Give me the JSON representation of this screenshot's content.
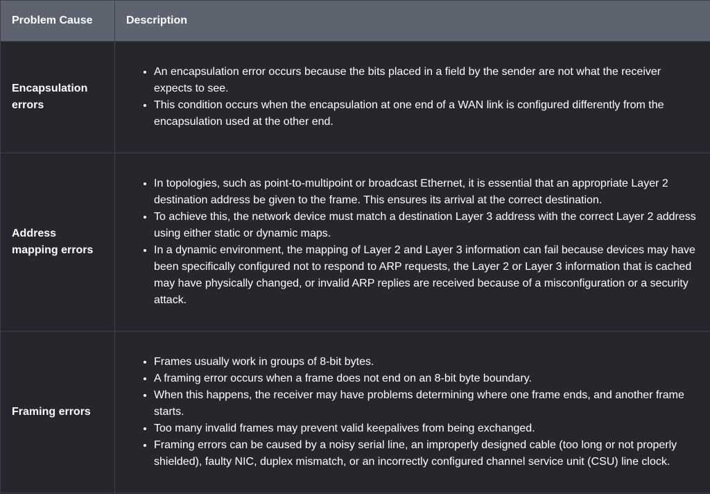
{
  "table": {
    "headers": [
      "Problem Cause",
      "Description"
    ],
    "rows": [
      {
        "cause": "Encapsulation errors",
        "bullets": [
          "An encapsulation error occurs because the bits placed in a field by the sender are not what the receiver expects to see.",
          "This condition occurs when the encapsulation at one end of a WAN link is configured differently from the encapsulation used at the other end."
        ]
      },
      {
        "cause": "Address mapping errors",
        "bullets": [
          "In topologies, such as point-to-multipoint or broadcast Ethernet, it is essential that an appropriate Layer 2 destination address be given to the frame. This ensures its arrival at the correct destination.",
          "To achieve this, the network device must match a destination Layer 3 address with the correct Layer 2 address using either static or dynamic maps.",
          "In a dynamic environment, the mapping of Layer 2 and Layer 3 information can fail because devices may have been specifically configured not to respond to ARP requests, the Layer 2 or Layer 3 information that is cached may have physically changed, or invalid ARP replies are received because of a misconfiguration or a security attack."
        ]
      },
      {
        "cause": "Framing errors",
        "bullets": [
          "Frames usually work in groups of 8-bit bytes.",
          "A framing error occurs when a frame does not end on an 8-bit byte boundary.",
          "When this happens, the receiver may have problems determining where one frame ends, and another frame starts.",
          "Too many invalid frames may prevent valid keepalives from being exchanged.",
          "Framing errors can be caused by a noisy serial line, an improperly designed cable (too long or not properly shielded), faulty NIC, duplex mismatch, or an incorrectly configured channel service unit (CSU) line clock."
        ]
      }
    ]
  }
}
